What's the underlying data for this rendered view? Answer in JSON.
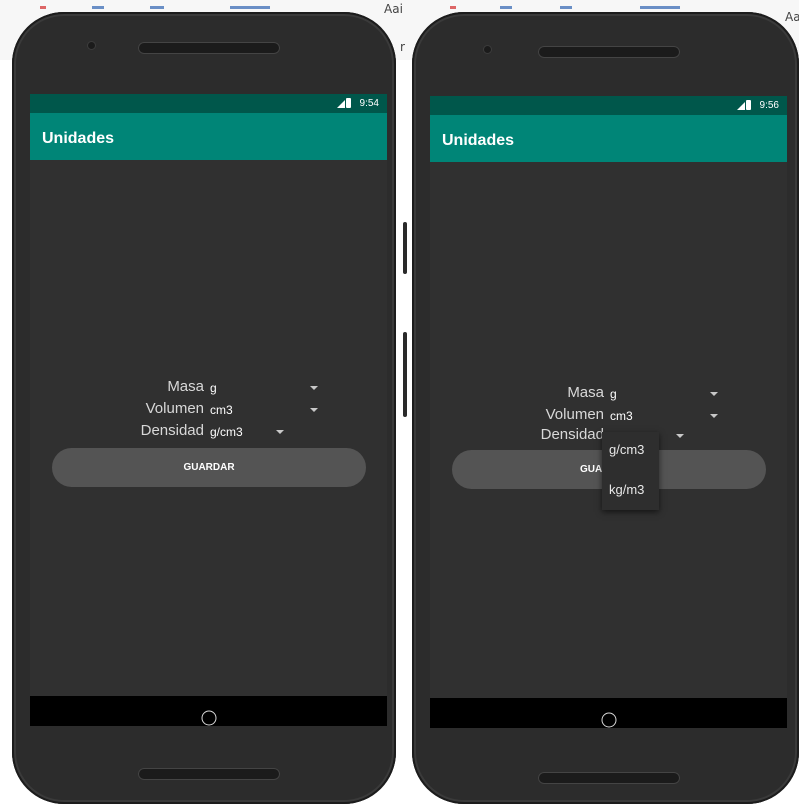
{
  "background": {
    "left_fragment": "Aai",
    "middle_fragment": "r",
    "right_fragment": "Aa"
  },
  "phones": [
    {
      "status_bar": {
        "time": "9:54"
      },
      "app_title": "Unidades",
      "form": {
        "masa_label": "Masa",
        "masa_value": "g",
        "volumen_label": "Volumen",
        "volumen_value": "cm3",
        "densidad_label": "Densidad",
        "densidad_value": "g/cm3"
      },
      "save_button_label": "GUARDAR"
    },
    {
      "status_bar": {
        "time": "9:56"
      },
      "app_title": "Unidades",
      "form": {
        "masa_label": "Masa",
        "masa_value": "g",
        "volumen_label": "Volumen",
        "volumen_value": "cm3",
        "densidad_label": "Densidad"
      },
      "save_button_label_partial": "GUA",
      "dropdown_options": [
        "g/cm3",
        "kg/m3"
      ]
    }
  ],
  "colors": {
    "status_bar": "#00574b",
    "app_bar": "#008577",
    "screen_background": "#303030",
    "button": "#545454"
  }
}
